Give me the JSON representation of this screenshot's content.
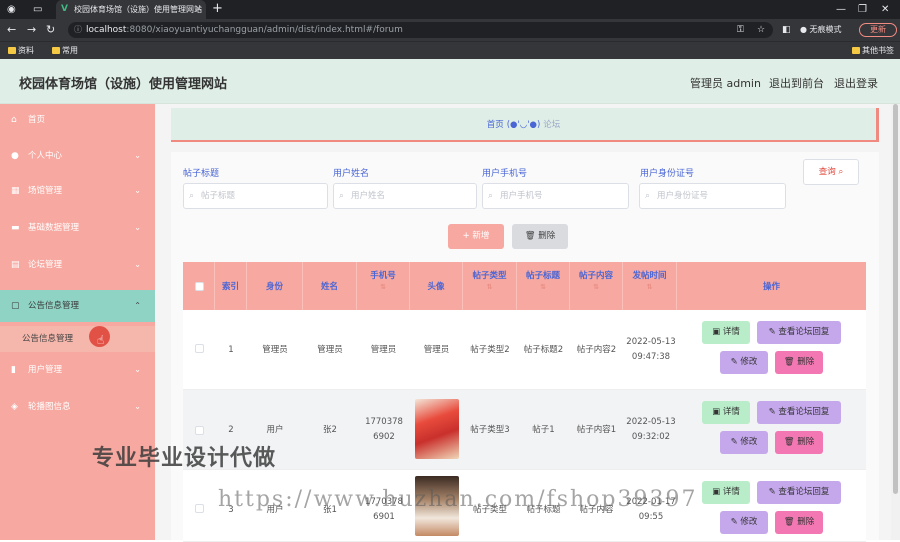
{
  "browser": {
    "tab_title": "校园体育场馆（设施）使用管理网站",
    "tab_close": "×",
    "new_tab": "+",
    "address_host": "localhost",
    "address_rest": ":8080/xiaoyuantiyuchangguan/admin/dist/index.html#/forum",
    "incognito_label": "无痕模式",
    "update_label": "更新",
    "bookmarks": [
      "资料",
      "常用"
    ],
    "other_bookmarks": "其他书签"
  },
  "header": {
    "site_title": "校园体育场馆（设施）使用管理网站",
    "admin_label": "管理员 admin",
    "exit_front": "退出到前台",
    "logout": "退出登录"
  },
  "sidebar": {
    "items": [
      {
        "label": "首页",
        "icon": "home-icon",
        "chevron": false
      },
      {
        "label": "个人中心",
        "icon": "user-icon",
        "chevron": true
      },
      {
        "label": "场馆管理",
        "icon": "building-icon",
        "chevron": true
      },
      {
        "label": "基础数据管理",
        "icon": "database-icon",
        "chevron": true
      },
      {
        "label": "论坛管理",
        "icon": "forum-icon",
        "chevron": true
      },
      {
        "label": "公告信息管理",
        "icon": "notice-icon",
        "chevron": true,
        "active": true
      },
      {
        "label": "用户管理",
        "icon": "chart-icon",
        "chevron": true
      },
      {
        "label": "轮播图信息",
        "icon": "carousel-icon",
        "chevron": true
      }
    ],
    "submenu_label": "公告信息管理"
  },
  "breadcrumb": {
    "home": "首页",
    "separator": "(●'◡'●)",
    "current": "论坛"
  },
  "search": {
    "fields": [
      {
        "label": "帖子标题",
        "placeholder": "帖子标题"
      },
      {
        "label": "用户姓名",
        "placeholder": "用户姓名"
      },
      {
        "label": "用户手机号",
        "placeholder": "用户手机号"
      },
      {
        "label": "用户身份证号",
        "placeholder": "用户身份证号"
      }
    ],
    "query_button": "查询"
  },
  "toolbar": {
    "add_button": "+ 新增",
    "delete_button": "删除"
  },
  "table": {
    "columns": [
      "索引",
      "身份",
      "姓名",
      "手机号",
      "头像",
      "帖子类型",
      "帖子标题",
      "帖子内容",
      "发帖时间",
      "操作"
    ],
    "rows": [
      {
        "index": "1",
        "identity": "管理员",
        "name": "管理员",
        "phone": "管理员",
        "avatar": "管理员",
        "type": "帖子类型2",
        "title": "帖子标题2",
        "content": "帖子内容2",
        "time": "2022-05-13 09:47:38"
      },
      {
        "index": "2",
        "identity": "用户",
        "name": "张2",
        "phone": "17703786902",
        "avatar": "",
        "type": "帖子类型3",
        "title": "帖子1",
        "content": "帖子内容1",
        "time": "2022-05-13 09:32:02"
      },
      {
        "index": "3",
        "identity": "用户",
        "name": "张1",
        "phone": "17703786901",
        "avatar": "",
        "type": "帖子类型",
        "title": "帖子标题",
        "content": "帖子内容",
        "time": "2022-01-17 09:55"
      }
    ],
    "actions": {
      "detail": "详情",
      "reply": "查看论坛回复",
      "edit": "修改",
      "remove": "删除"
    }
  },
  "watermarks": {
    "text1": "专业毕业设计代做",
    "text2": "https://www.huzhan.com/fshop39397"
  },
  "colors": {
    "accent_pink": "#f7a8a0",
    "header_green": "#dfeee6",
    "active_teal": "#8fd3c5",
    "link_blue": "#4a66d6",
    "detail_green": "#b9ecc8",
    "purple": "#c5a8ec",
    "delete_pink": "#f277b3"
  }
}
